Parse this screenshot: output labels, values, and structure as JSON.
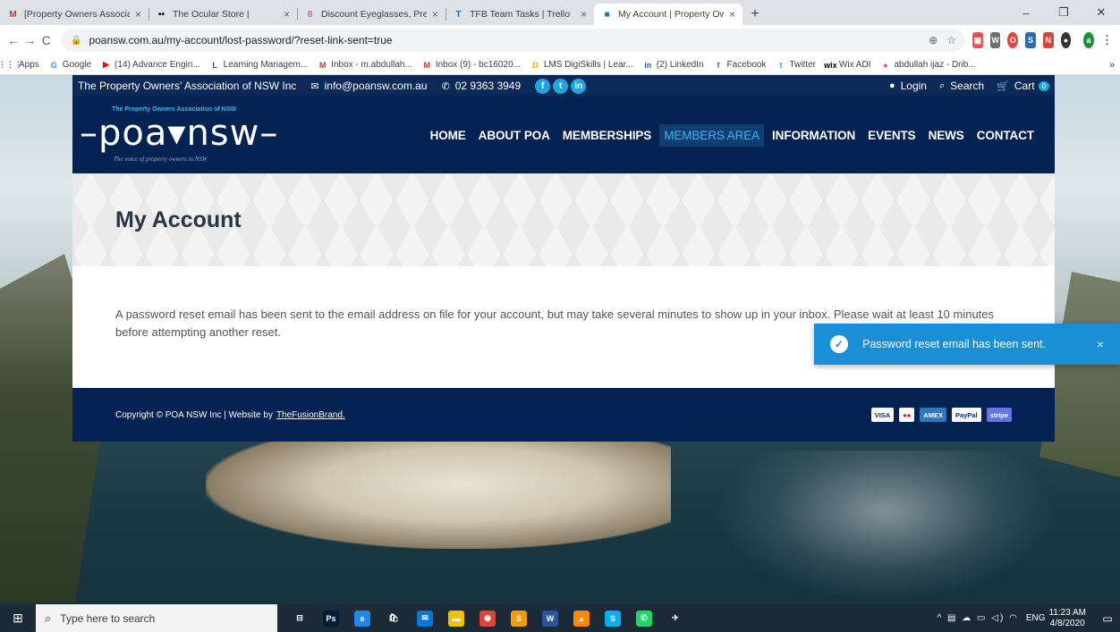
{
  "browser": {
    "tabs": [
      {
        "title": "[Property Owners Association of",
        "favicon": "M",
        "favicon_color": "#d93025",
        "active": false
      },
      {
        "title": "The Ocular Store |",
        "favicon": "••",
        "favicon_color": "#000000",
        "active": false
      },
      {
        "title": "Discount Eyeglasses, Prescription",
        "favicon": "8",
        "favicon_color": "#c26b9c",
        "active": false
      },
      {
        "title": "TFB Team Tasks | Trello",
        "favicon": "T",
        "favicon_color": "#0079bf",
        "active": false
      },
      {
        "title": "My Account | Property Owners A",
        "favicon": "■",
        "favicon_color": "#1a73c8",
        "active": true
      }
    ],
    "new_tab": "+",
    "url": "poansw.com.au/my-account/lost-password/?reset-link-sent=true",
    "bookmarks": [
      {
        "label": "Apps",
        "icon": "⋮⋮⋮",
        "color": "#1a73e8"
      },
      {
        "label": "Google",
        "icon": "G",
        "color": "#4285f4"
      },
      {
        "label": "(14) Advance Engin...",
        "icon": "▶",
        "color": "#ff0000"
      },
      {
        "label": "Learning Managem...",
        "icon": "L",
        "color": "#2b5797"
      },
      {
        "label": "Inbox - m.abdullah...",
        "icon": "M",
        "color": "#d93025"
      },
      {
        "label": "Inbox (9) - bc16020...",
        "icon": "M",
        "color": "#d93025"
      },
      {
        "label": "LMS DigiSkills | Lear...",
        "icon": "D",
        "color": "#f2a900"
      },
      {
        "label": "(2) LinkedIn",
        "icon": "in",
        "color": "#0a66c2"
      },
      {
        "label": "Facebook",
        "icon": "f",
        "color": "#1877f2"
      },
      {
        "label": "Twitter",
        "icon": "t",
        "color": "#1da1f2"
      },
      {
        "label": "Wix ADI",
        "icon": "wix",
        "color": "#000000"
      },
      {
        "label": "abdullah ijaz - Drib...",
        "icon": "●",
        "color": "#ea4c89"
      }
    ],
    "bookmarks_more": "»"
  },
  "site": {
    "topbar": {
      "org_name": "The Property Owners' Association of NSW Inc",
      "email": "info@poansw.com.au",
      "phone": "02 9363 3949",
      "social": [
        "f",
        "t",
        "in"
      ],
      "login": "Login",
      "search": "Search",
      "cart": "Cart",
      "cart_count": "0"
    },
    "logo": {
      "tag_top": "The Property Owners Association of NSW",
      "wordmark": "–poa▾nsw–",
      "tag_bottom": "The voice of property owners in NSW"
    },
    "nav": [
      {
        "label": "HOME",
        "active": false
      },
      {
        "label": "ABOUT POA",
        "active": false
      },
      {
        "label": "MEMBERSHIPS",
        "active": false
      },
      {
        "label": "MEMBERS AREA",
        "active": true
      },
      {
        "label": "INFORMATION",
        "active": false
      },
      {
        "label": "EVENTS",
        "active": false
      },
      {
        "label": "NEWS",
        "active": false
      },
      {
        "label": "CONTACT",
        "active": false
      }
    ],
    "page_title": "My Account",
    "message": "A password reset email has been sent to the email address on file for your account, but may take several minutes to show up in your inbox. Please wait at least 10 minutes before attempting another reset.",
    "footer": {
      "copyright": "Copyright © POA NSW Inc | Website by",
      "credit_link": "TheFusionBrand.",
      "cards": [
        {
          "label": "VISA",
          "bg": "#ffffff",
          "fg": "#1a1f71"
        },
        {
          "label": "●●",
          "bg": "#ffffff",
          "fg": "#eb001b"
        },
        {
          "label": "AMEX",
          "bg": "#2e77bb",
          "fg": "#ffffff"
        },
        {
          "label": "PayPal",
          "bg": "#ffffff",
          "fg": "#003087"
        },
        {
          "label": "stripe",
          "bg": "#6772e5",
          "fg": "#ffffff"
        }
      ]
    }
  },
  "toast": {
    "message": "Password reset email has been sent.",
    "close": "×"
  },
  "taskbar": {
    "search_placeholder": "Type here to search",
    "apps": [
      {
        "label": "⊟",
        "bg": "transparent"
      },
      {
        "label": "Ps",
        "bg": "#001e36"
      },
      {
        "label": "e",
        "bg": "#1e88e5"
      },
      {
        "label": "🛍",
        "bg": "transparent"
      },
      {
        "label": "✉",
        "bg": "#0078d4"
      },
      {
        "label": "▬",
        "bg": "#f2c200"
      },
      {
        "label": "◉",
        "bg": "#db4437"
      },
      {
        "label": "S",
        "bg": "#f59b00"
      },
      {
        "label": "W",
        "bg": "#2b579a"
      },
      {
        "label": "▲",
        "bg": "#ff8800"
      },
      {
        "label": "S",
        "bg": "#00aff0"
      },
      {
        "label": "✆",
        "bg": "#25d366"
      },
      {
        "label": "✈",
        "bg": "transparent"
      }
    ],
    "lang": "ENG",
    "time": "11:23 AM",
    "date": "4/8/2020"
  },
  "colors": {
    "site_navy": "#042352",
    "accent_blue": "#1fa6e0",
    "toast_blue": "#1a8fd6"
  }
}
